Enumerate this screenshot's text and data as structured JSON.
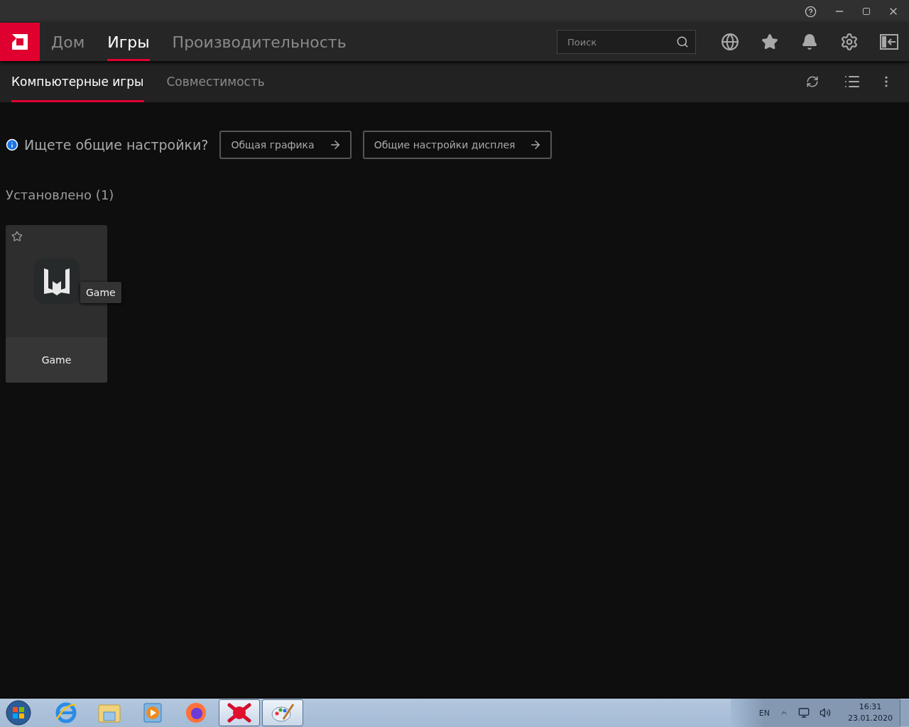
{
  "nav": {
    "tabs": [
      {
        "label": "Дом",
        "selected": false
      },
      {
        "label": "Игры",
        "selected": true
      },
      {
        "label": "Производительность",
        "selected": false
      }
    ],
    "search": {
      "placeholder": "Поиск"
    }
  },
  "subnav": {
    "tabs": [
      {
        "label": "Компьютерные игры",
        "selected": true
      },
      {
        "label": "Совместимость",
        "selected": false
      }
    ]
  },
  "hint": {
    "text": "Ищете общие настройки?",
    "buttons": [
      "Общая графика",
      "Общие настройки дисплея"
    ]
  },
  "installed": {
    "heading": "Установлено (1)",
    "games": [
      {
        "title": "Game",
        "tooltip": "Game",
        "favorite": false
      }
    ]
  },
  "taskbar": {
    "apps": [
      {
        "running": false
      },
      {
        "running": false
      },
      {
        "running": false
      },
      {
        "running": false
      },
      {
        "running": true
      },
      {
        "running": true
      }
    ],
    "language": "EN",
    "time": "16:31",
    "date": "23.01.2020"
  }
}
